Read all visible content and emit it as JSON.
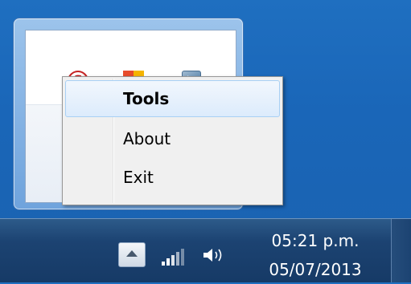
{
  "context_menu": {
    "items": [
      {
        "label": "Tools",
        "bold": true,
        "highlighted": true
      },
      {
        "label": "About"
      },
      {
        "label": "Exit"
      }
    ]
  },
  "tray_overflow": {
    "icons": [
      "s-shield-icon",
      "avg-antivirus-icon",
      "app-arrow-icon"
    ]
  },
  "taskbar": {
    "clock": {
      "time": "05:21 p.m.",
      "date": "05/07/2013"
    },
    "icons": [
      "show-hidden-icons-button",
      "network-signal-icon",
      "volume-icon"
    ]
  }
}
